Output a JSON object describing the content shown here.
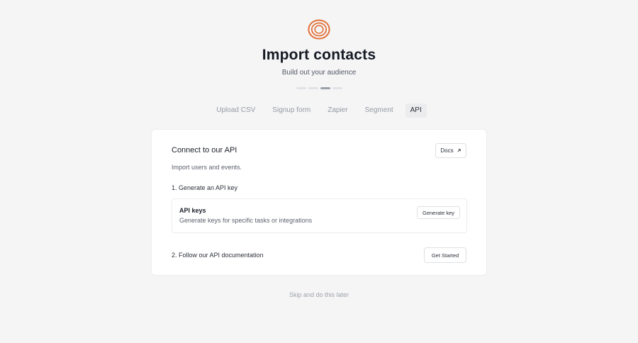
{
  "header": {
    "logo_icon": "concentric-rings-logo",
    "title": "Import contacts",
    "subtitle": "Build out your audience",
    "accent_color": "#e2713a"
  },
  "progress": {
    "total_steps": 4,
    "current_step": 3
  },
  "tabs": [
    {
      "label": "Upload CSV",
      "active": false
    },
    {
      "label": "Signup form",
      "active": false
    },
    {
      "label": "Zapier",
      "active": false
    },
    {
      "label": "Segment",
      "active": false
    },
    {
      "label": "API",
      "active": true
    }
  ],
  "card": {
    "title": "Connect to our API",
    "docs_label": "Docs",
    "docs_icon": "external-arrow-icon",
    "description": "Import users and events.",
    "step1": "1. Generate an API key",
    "keys_box": {
      "title": "API keys",
      "description": "Generate keys for specific tasks or integrations",
      "button_label": "Generate key"
    },
    "step2": "2. Follow our API documentation",
    "get_started_label": "Get Started"
  },
  "footer": {
    "skip_label": "Skip and do this later"
  }
}
